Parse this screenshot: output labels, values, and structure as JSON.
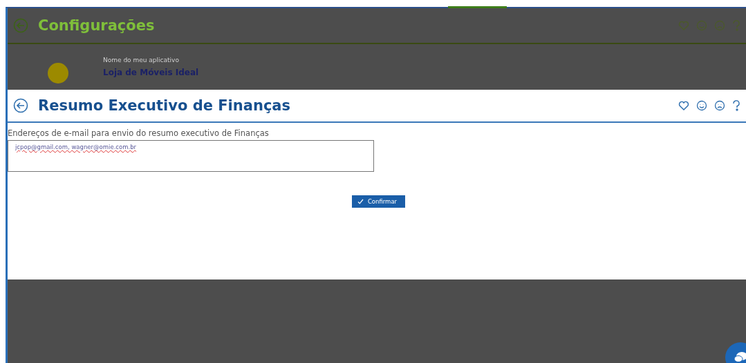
{
  "background_page": {
    "title": "Configurações",
    "app_name_label": "Nome do meu aplicativo",
    "app_name": "Loja de Móveis Ideal"
  },
  "dialog": {
    "title": "Resumo Executivo de Finanças",
    "email_label": "Endereços de e-mail para envio do resumo executivo de Finanças",
    "email_value": "jcpop@gmail.com, wagner@omie.com.br",
    "confirm_button": "Confirmar"
  }
}
